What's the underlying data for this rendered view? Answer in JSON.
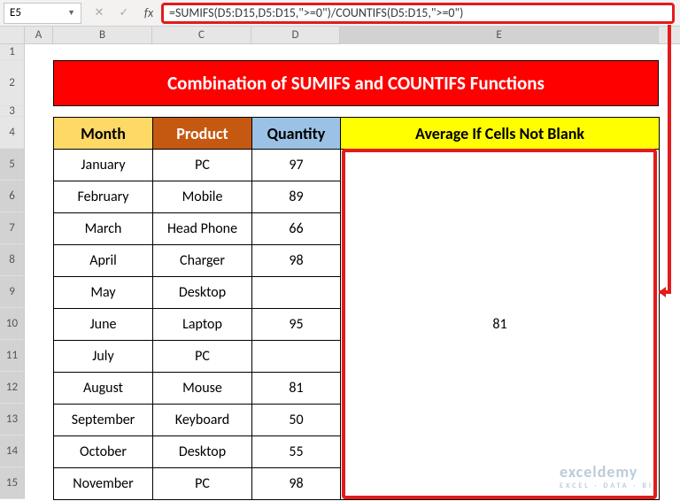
{
  "name_box": "E5",
  "fx_buttons": {
    "cancel": "✕",
    "confirm": "✓",
    "fx": "fx"
  },
  "formula": "=SUMIFS(D5:D15,D5:D15,\">=0\")/COUNTIFS(D5:D15,\">=0\")",
  "columns": [
    "",
    "A",
    "B",
    "C",
    "D",
    "E"
  ],
  "row_labels": [
    "1",
    "2",
    "3",
    "4",
    "5",
    "6",
    "7",
    "8",
    "9",
    "10",
    "11",
    "12",
    "13",
    "14",
    "15"
  ],
  "title": "Combination of SUMIFS and COUNTIFS Functions",
  "headers": {
    "month": "Month",
    "product": "Product",
    "quantity": "Quantity",
    "average": "Average If Cells Not Blank"
  },
  "rows": [
    {
      "month": "January",
      "product": "PC",
      "qty": "97"
    },
    {
      "month": "February",
      "product": "Mobile",
      "qty": "89"
    },
    {
      "month": "March",
      "product": "Head Phone",
      "qty": "66"
    },
    {
      "month": "April",
      "product": "Charger",
      "qty": "98"
    },
    {
      "month": "May",
      "product": "Desktop",
      "qty": ""
    },
    {
      "month": "June",
      "product": "Laptop",
      "qty": "95"
    },
    {
      "month": "July",
      "product": "PC",
      "qty": ""
    },
    {
      "month": "August",
      "product": "Mouse",
      "qty": "81"
    },
    {
      "month": "September",
      "product": "Keyboard",
      "qty": "50"
    },
    {
      "month": "October",
      "product": "Desktop",
      "qty": "55"
    },
    {
      "month": "November",
      "product": "PC",
      "qty": "98"
    }
  ],
  "average_value": "81",
  "watermark": {
    "main": "exceldemy",
    "sub": "EXCEL · DATA · BI"
  }
}
